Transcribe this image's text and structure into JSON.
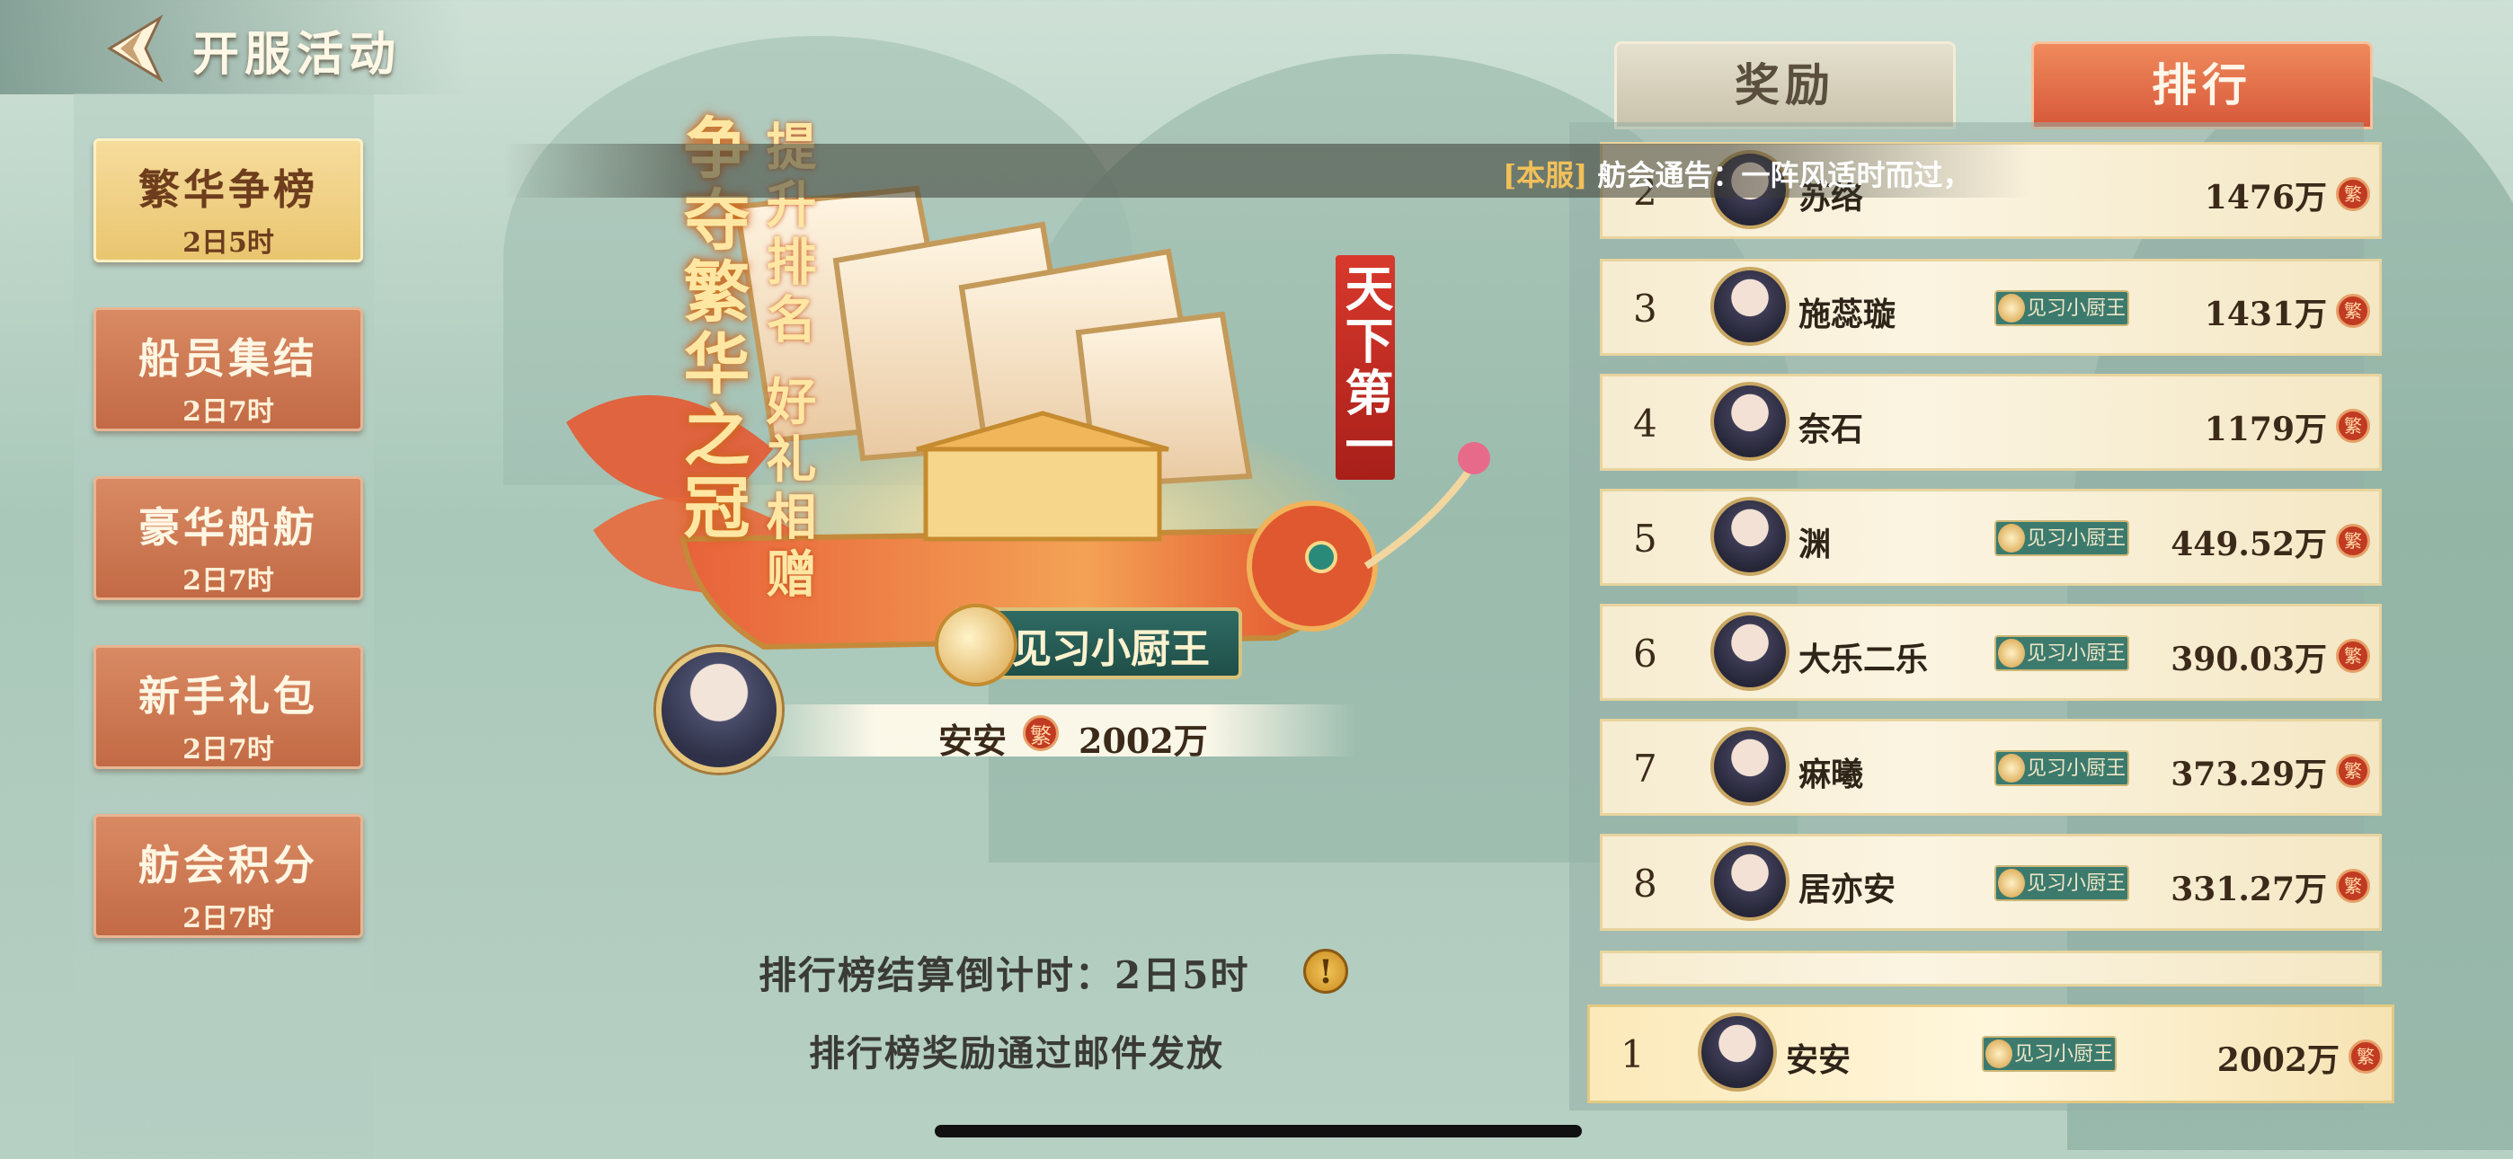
{
  "header": {
    "title": "开服活动",
    "back_icon": "back-arrow-icon"
  },
  "sidebar": {
    "items": [
      {
        "label": "繁华争榜",
        "time": "2日5时",
        "active": true
      },
      {
        "label": "船员集结",
        "time": "2日7时",
        "active": false
      },
      {
        "label": "豪华船舫",
        "time": "2日7时",
        "active": false
      },
      {
        "label": "新手礼包",
        "time": "2日7时",
        "active": false
      },
      {
        "label": "舫会积分",
        "time": "2日7时",
        "active": false
      }
    ]
  },
  "hero": {
    "title_big": "争夺繁华之冠",
    "title_small": "提升排名 好礼相赠",
    "banner": "天下第一",
    "badge": "见习小厨王",
    "top_player": {
      "name": "安安",
      "score": "2002万"
    }
  },
  "currency_icon": "繁",
  "countdown_text": "排行榜结算倒计时：2日5时",
  "mail_note": "排行榜奖励通过邮件发放",
  "tabs": {
    "reward": "奖励",
    "rank": "排行"
  },
  "notice": {
    "tag": "[本服]",
    "text": "舫会通告：一阵风适时而过，"
  },
  "ranking": [
    {
      "rank": "2",
      "name": "苏络",
      "tag": "",
      "score": "1476万"
    },
    {
      "rank": "3",
      "name": "施蕊璇",
      "tag": "见习小厨王",
      "score": "1431万"
    },
    {
      "rank": "4",
      "name": "奈石",
      "tag": "",
      "score": "1179万"
    },
    {
      "rank": "5",
      "name": "渊",
      "tag": "见习小厨王",
      "score": "449.52万"
    },
    {
      "rank": "6",
      "name": "大乐二乐",
      "tag": "见习小厨王",
      "score": "390.03万"
    },
    {
      "rank": "7",
      "name": "痳曦",
      "tag": "见习小厨王",
      "score": "373.29万"
    },
    {
      "rank": "8",
      "name": "居亦安",
      "tag": "见习小厨王",
      "score": "331.27万"
    }
  ],
  "self_rank": {
    "rank": "1",
    "name": "安安",
    "tag": "见习小厨王",
    "score": "2002万"
  },
  "colors": {
    "accent": "#d7583a",
    "gold": "#e9c56f",
    "teal": "#3c7a6e"
  }
}
